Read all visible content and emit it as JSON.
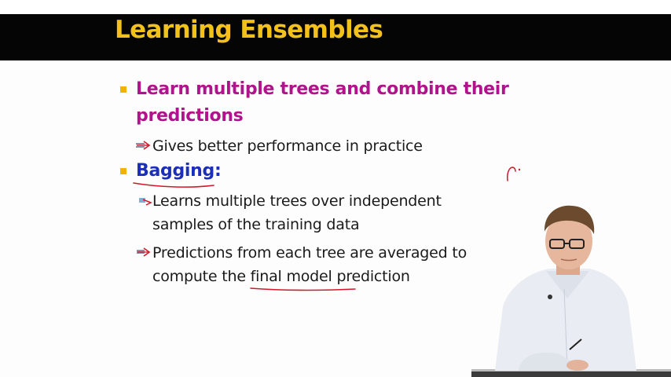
{
  "slide": {
    "title": "Learning Ensembles",
    "bullets": [
      {
        "text_line1": "Learn multiple trees and combine their",
        "text_line2": "predictions",
        "sub": [
          {
            "text_line1": "Gives better performance in practice"
          }
        ]
      },
      {
        "text_line1": "Bagging:",
        "sub": [
          {
            "text_line1": "Learns multiple trees over independent",
            "text_line2": "samples of the training data"
          },
          {
            "text_line1": "Predictions from each tree are averaged to",
            "text_line2": "compute the final model prediction"
          }
        ]
      }
    ]
  },
  "colors": {
    "title_bar": "#050505",
    "title_text": "#f2c21a",
    "bullet_magenta": "#b0138b",
    "bullet_blue": "#1b2fb8",
    "bullet_square": "#f0b400",
    "ink_red": "#d2182a"
  },
  "icons": {
    "sub_bullet": "arrow-bullet-icon"
  }
}
